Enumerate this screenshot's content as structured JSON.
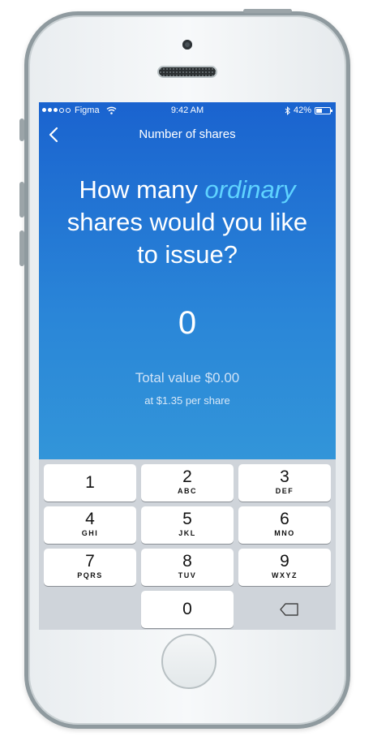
{
  "status_bar": {
    "carrier": "Figma",
    "time": "9:42 AM",
    "battery": "42%",
    "battery_level": 0.42
  },
  "nav": {
    "title": "Number of shares",
    "back_icon": "chevron-left-icon"
  },
  "question": {
    "before": "How many ",
    "highlight": "ordinary",
    "after": " shares would you like to issue?"
  },
  "amount": "0",
  "total_value": "Total value $0.00",
  "price_per_share": "at $1.35 per share",
  "colors": {
    "hero_top": "#1a63cf",
    "hero_bottom": "#3295d9",
    "highlight": "#5fd3ff",
    "keypad_bg": "#cfd4da"
  },
  "keypad": {
    "keys": [
      {
        "num": "1",
        "letters": ""
      },
      {
        "num": "2",
        "letters": "ABC"
      },
      {
        "num": "3",
        "letters": "DEF"
      },
      {
        "num": "4",
        "letters": "GHI"
      },
      {
        "num": "5",
        "letters": "JKL"
      },
      {
        "num": "6",
        "letters": "MNO"
      },
      {
        "num": "7",
        "letters": "PQRS"
      },
      {
        "num": "8",
        "letters": "TUV"
      },
      {
        "num": "9",
        "letters": "WXYZ"
      },
      {
        "num": "0",
        "letters": ""
      }
    ],
    "delete_icon": "backspace-icon"
  }
}
